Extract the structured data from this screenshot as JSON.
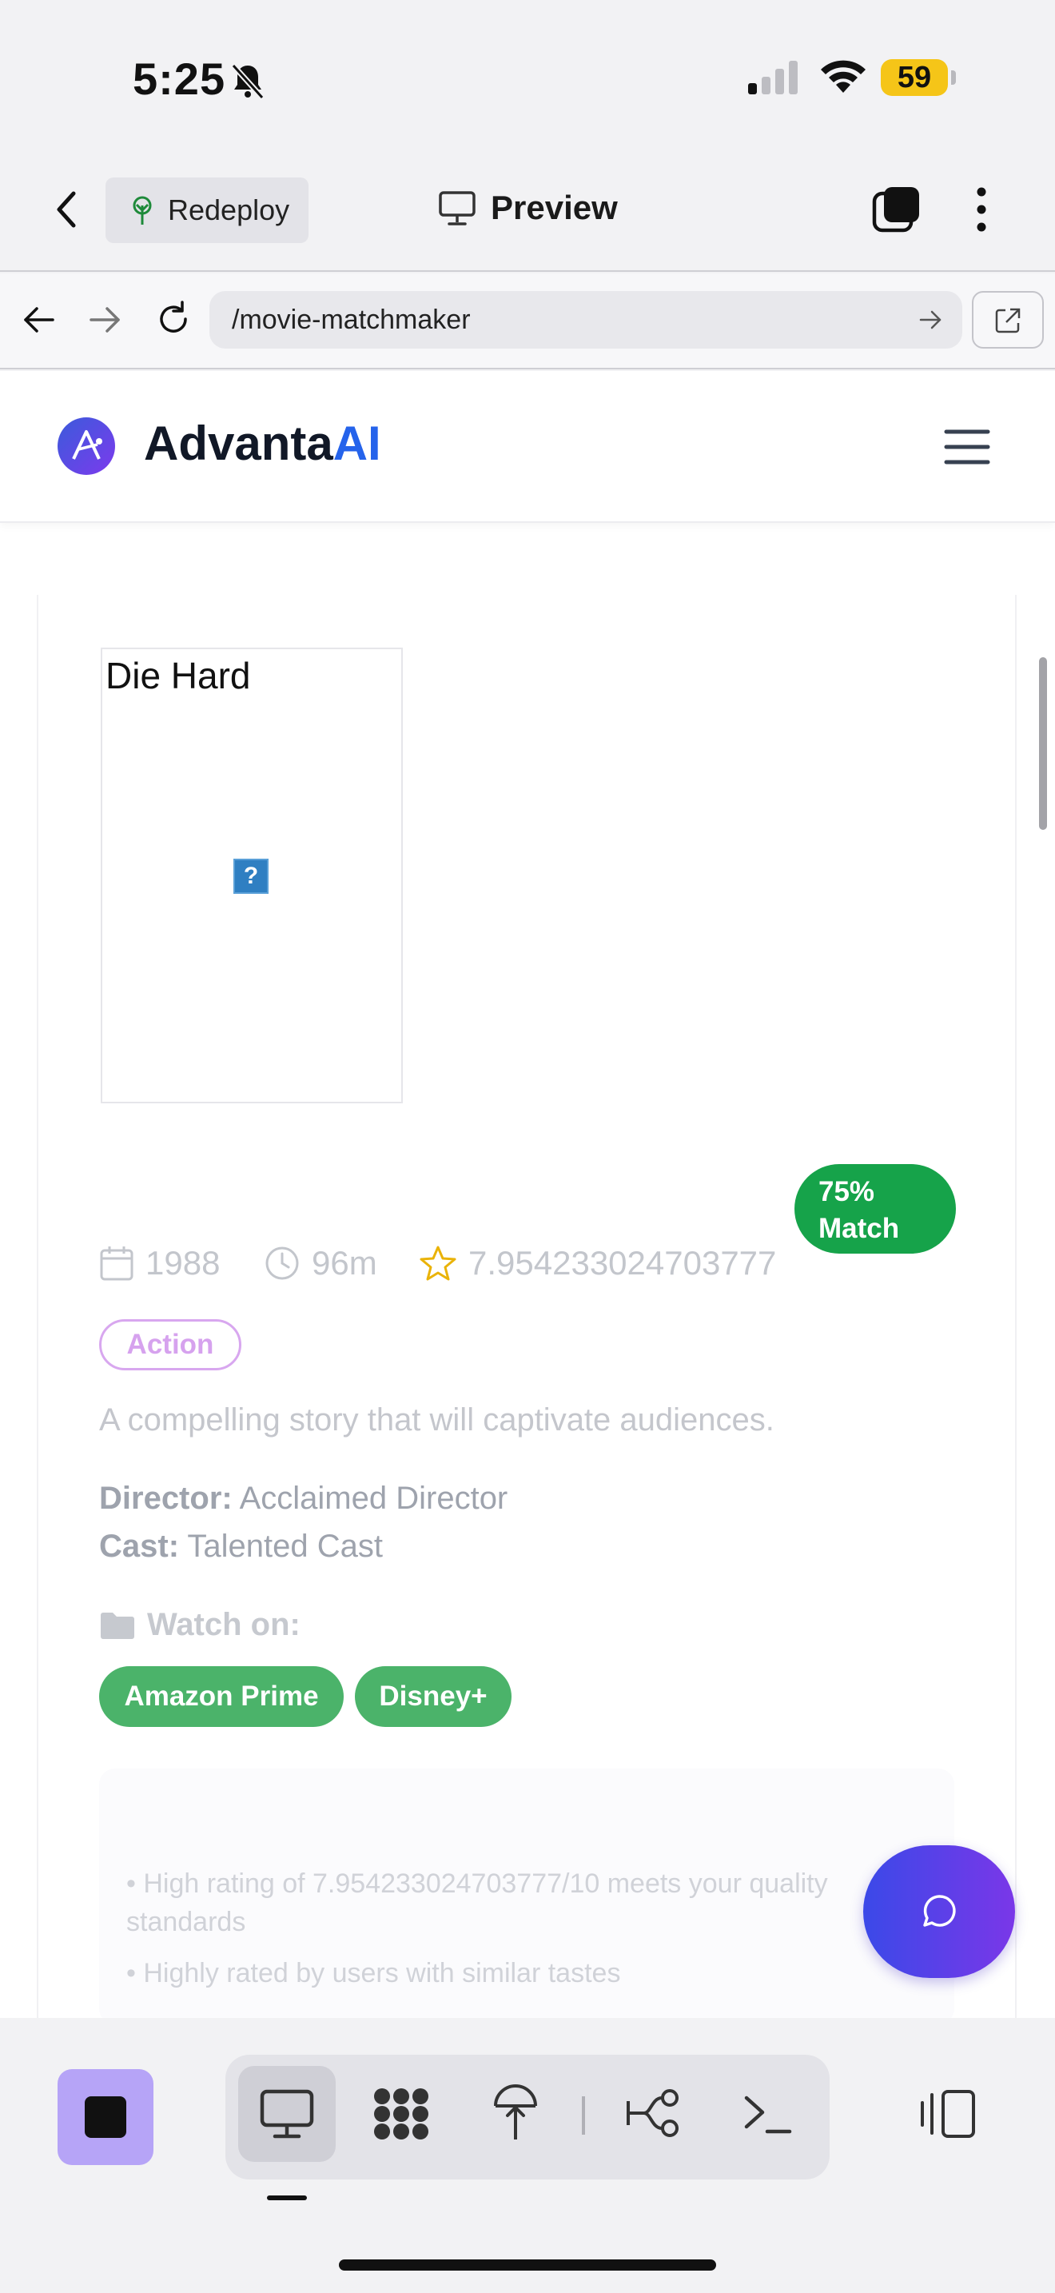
{
  "status": {
    "time": "5:25",
    "battery": "59"
  },
  "topnav": {
    "redeploy_label": "Redeploy",
    "preview_label": "Preview"
  },
  "urlbar": {
    "url": "/movie-matchmaker"
  },
  "app": {
    "brand_main": "Advanta",
    "brand_accent": "AI"
  },
  "movie": {
    "title": "Die Hard",
    "year": "1988",
    "runtime": "96m",
    "rating": "7.954233024703777",
    "match": "75% Match",
    "genre": "Action",
    "description": "A compelling story that will captivate audiences.",
    "director_label": "Director:",
    "director": "Acclaimed Director",
    "cast_label": "Cast:",
    "cast": "Talented Cast",
    "watch_label": "Watch on:",
    "platforms": [
      "Amazon Prime",
      "Disney+"
    ],
    "reasons": [
      "• High rating of 7.954233024703777/10 meets your quality standards",
      "• Highly rated by users with similar tastes"
    ]
  },
  "colors": {
    "match_badge": "#16a34a",
    "platform_badge": "#4bb36a",
    "brand_accent": "#2563eb",
    "chat_fab_start": "#3b49e8",
    "chat_fab_end": "#7a37e8"
  },
  "icons": [
    "back-chevron-icon",
    "tree-icon",
    "monitor-icon",
    "tabs-icon",
    "more-vertical-icon",
    "arrow-left-icon",
    "arrow-right-icon",
    "reload-icon",
    "go-arrow-icon",
    "external-link-icon",
    "menu-icon",
    "calendar-icon",
    "clock-icon",
    "star-icon",
    "folder-icon",
    "chat-icon",
    "desktop-icon",
    "apps-icon",
    "deploy-icon",
    "branch-icon",
    "terminal-icon",
    "split-view-icon"
  ]
}
